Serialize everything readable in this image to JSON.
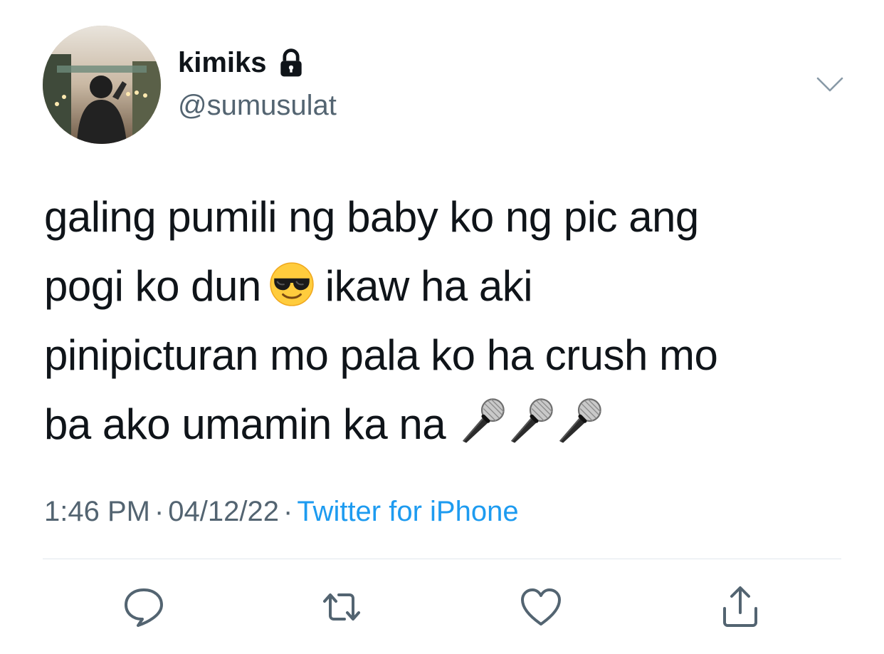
{
  "user": {
    "display_name": "kimiks",
    "handle": "@sumusulat",
    "protected_icon": "lock-icon",
    "avatar_icon": "profile-photo"
  },
  "tweet": {
    "lines": [
      {
        "text": "galing pumili ng baby ko ng pic ang"
      },
      {
        "before": "pogi ko dun",
        "emoji": "😎",
        "after": "ikaw ha aki"
      },
      {
        "text": "pinipicturan mo pala ko ha crush mo"
      },
      {
        "before": "ba ako umamin ka na",
        "emoji": "🎤🎤🎤"
      }
    ]
  },
  "meta": {
    "time": "1:46 PM",
    "separator": "·",
    "date": "04/12/22",
    "source": "Twitter for iPhone"
  },
  "actions": [
    {
      "name": "reply",
      "icon": "reply-icon"
    },
    {
      "name": "retweet",
      "icon": "retweet-icon"
    },
    {
      "name": "like",
      "icon": "heart-icon"
    },
    {
      "name": "share",
      "icon": "share-icon"
    }
  ],
  "colors": {
    "text": "#0f1419",
    "secondary": "#536471",
    "link": "#1d9bf0",
    "divider": "#e1e8ed"
  }
}
